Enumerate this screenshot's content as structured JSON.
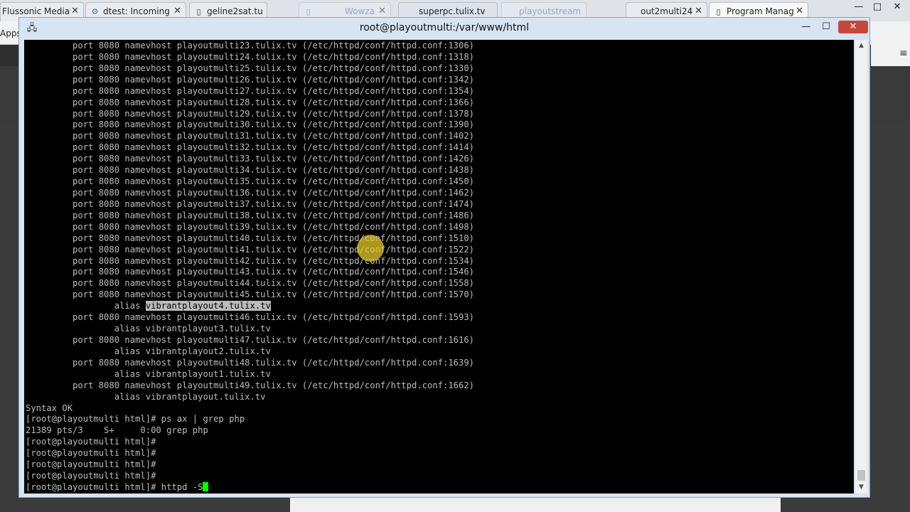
{
  "browser": {
    "tabs": [
      {
        "label": "Flussonic Media",
        "icon": "flussonic-icon"
      },
      {
        "label": "dtest: Incoming",
        "icon": "dtest-icon"
      },
      {
        "label": "geline2sat.tu",
        "icon": "page-icon"
      },
      {
        "label": "Wowza",
        "icon": "wowza-icon"
      },
      {
        "label": "superpc.tulix.tv",
        "icon": "page-icon"
      },
      {
        "label": "playoutstream",
        "icon": "page-icon"
      },
      {
        "label": "out2multi24",
        "icon": "page-icon"
      },
      {
        "label": "Program Manag",
        "icon": "page-icon"
      }
    ],
    "apps_label": "Apps"
  },
  "putty": {
    "title": "root@playoutmulti:/var/www/html",
    "lines": [
      "         port 8080 namevhost playoutmulti23.tulix.tv (/etc/httpd/conf/httpd.conf:1306)",
      "         port 8080 namevhost playoutmulti24.tulix.tv (/etc/httpd/conf/httpd.conf:1318)",
      "         port 8080 namevhost playoutmulti25.tulix.tv (/etc/httpd/conf/httpd.conf:1330)",
      "         port 8080 namevhost playoutmulti26.tulix.tv (/etc/httpd/conf/httpd.conf:1342)",
      "         port 8080 namevhost playoutmulti27.tulix.tv (/etc/httpd/conf/httpd.conf:1354)",
      "         port 8080 namevhost playoutmulti28.tulix.tv (/etc/httpd/conf/httpd.conf:1366)",
      "         port 8080 namevhost playoutmulti29.tulix.tv (/etc/httpd/conf/httpd.conf:1378)",
      "         port 8080 namevhost playoutmulti30.tulix.tv (/etc/httpd/conf/httpd.conf:1390)",
      "         port 8080 namevhost playoutmulti31.tulix.tv (/etc/httpd/conf/httpd.conf:1402)",
      "         port 8080 namevhost playoutmulti32.tulix.tv (/etc/httpd/conf/httpd.conf:1414)",
      "         port 8080 namevhost playoutmulti33.tulix.tv (/etc/httpd/conf/httpd.conf:1426)",
      "         port 8080 namevhost playoutmulti34.tulix.tv (/etc/httpd/conf/httpd.conf:1438)",
      "         port 8080 namevhost playoutmulti35.tulix.tv (/etc/httpd/conf/httpd.conf:1450)",
      "         port 8080 namevhost playoutmulti36.tulix.tv (/etc/httpd/conf/httpd.conf:1462)",
      "         port 8080 namevhost playoutmulti37.tulix.tv (/etc/httpd/conf/httpd.conf:1474)",
      "         port 8080 namevhost playoutmulti38.tulix.tv (/etc/httpd/conf/httpd.conf:1486)",
      "         port 8080 namevhost playoutmulti39.tulix.tv (/etc/httpd/conf/httpd.conf:1498)",
      "         port 8080 namevhost playoutmulti40.tulix.tv (/etc/httpd/conf/httpd.conf:1510)",
      "         port 8080 namevhost playoutmulti41.tulix.tv (/etc/httpd/conf/httpd.conf:1522)",
      "         port 8080 namevhost playoutmulti42.tulix.tv (/etc/httpd/conf/httpd.conf:1534)",
      "         port 8080 namevhost playoutmulti43.tulix.tv (/etc/httpd/conf/httpd.conf:1546)",
      "         port 8080 namevhost playoutmulti44.tulix.tv (/etc/httpd/conf/httpd.conf:1558)",
      "         port 8080 namevhost playoutmulti45.tulix.tv (/etc/httpd/conf/httpd.conf:1570)",
      "                 alias ",
      "         port 8080 namevhost playoutmulti46.tulix.tv (/etc/httpd/conf/httpd.conf:1593)",
      "                 alias vibrantplayout3.tulix.tv",
      "         port 8080 namevhost playoutmulti47.tulix.tv (/etc/httpd/conf/httpd.conf:1616)",
      "                 alias vibrantplayout2.tulix.tv",
      "         port 8080 namevhost playoutmulti48.tulix.tv (/etc/httpd/conf/httpd.conf:1639)",
      "                 alias vibrantplayout1.tulix.tv",
      "         port 8080 namevhost playoutmulti49.tulix.tv (/etc/httpd/conf/httpd.conf:1662)",
      "                 alias vibrantplayout.tulix.tv",
      "Syntax OK",
      "[root@playoutmulti html]# ps ax | grep php",
      "21389 pts/3    S+     0:00 grep php",
      "[root@playoutmulti html]#",
      "[root@playoutmulti html]#",
      "[root@playoutmulti html]#",
      "[root@playoutmulti html]#",
      "[root@playoutmulti html]# httpd -S"
    ],
    "selected_text": "vibrantplayout4.tulix.tv"
  },
  "colors": {
    "terminal_bg": "#000000",
    "terminal_fg": "#bbbbbb",
    "cursor": "#00ff00",
    "selection_bg": "#bbbbbb",
    "close_button": "#c9463d"
  }
}
